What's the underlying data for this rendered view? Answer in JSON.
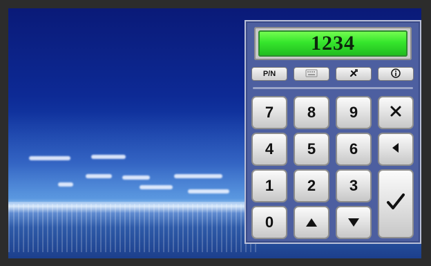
{
  "display": {
    "value": "1234"
  },
  "toolbar": [
    {
      "label": "P/N",
      "icon": ""
    },
    {
      "label": "",
      "icon": "keyboard-icon"
    },
    {
      "label": "",
      "icon": "tools-icon"
    },
    {
      "label": "",
      "icon": "info-icon"
    }
  ],
  "keypad": {
    "rows": [
      [
        "7",
        "8",
        "9"
      ],
      [
        "4",
        "5",
        "6"
      ],
      [
        "1",
        "2",
        "3"
      ],
      [
        "0",
        "up-arrow-icon",
        "down-arrow-icon"
      ]
    ],
    "side_keys": [
      "clear-icon",
      "backspace-icon",
      "enter-check-icon"
    ]
  },
  "colors": {
    "panel": "#4d5fa0",
    "display_green": "#36e62c"
  }
}
